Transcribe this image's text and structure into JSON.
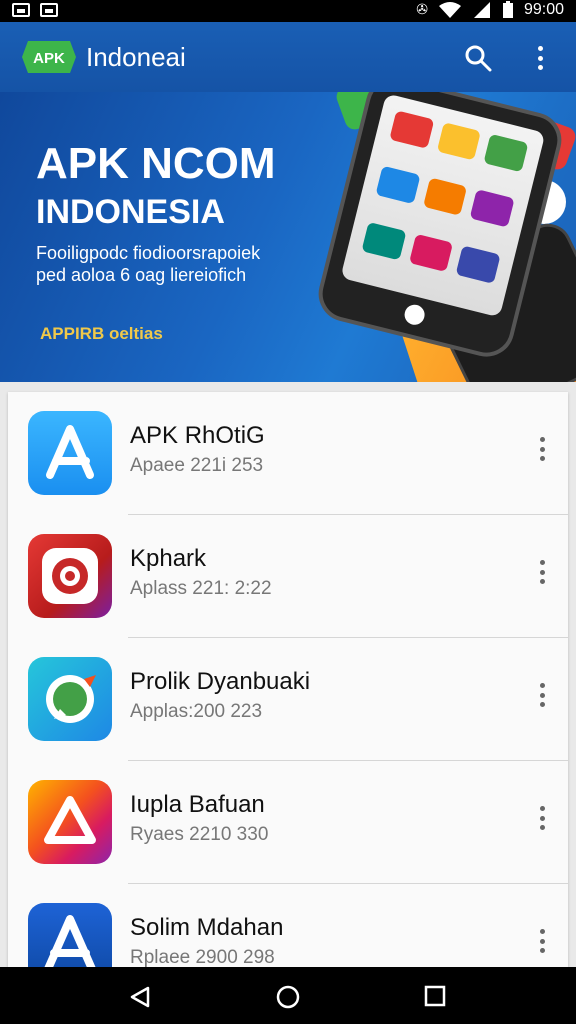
{
  "status_bar": {
    "time": "99:00",
    "icons": [
      "image-icon",
      "image-icon",
      "vibrate-icon",
      "wifi-icon",
      "signal-icon",
      "battery-icon"
    ]
  },
  "app_bar": {
    "logo_text": "APK",
    "title": "Indoneai",
    "search_icon": "search-icon",
    "menu_icon": "more-vert-icon"
  },
  "hero": {
    "title_line1": "APK NCOM",
    "title_line2": "INDONESIA",
    "subtitle_line1": "Fooiligpodc fiodioorsrapoiek",
    "subtitle_line2": "ped aoloa 6 oag liereiofich",
    "badge": "APPIRB oeltias"
  },
  "apps": [
    {
      "name": "APK RhOtiG",
      "meta": "Apaee 221i 253",
      "icon": "appstore-a-icon"
    },
    {
      "name": "Kphark",
      "meta": "Aplass 221: 2:22",
      "icon": "camera-ring-icon"
    },
    {
      "name": "Prolik Dyanbuaki",
      "meta": "Applas:200 223",
      "icon": "chat-bubble-icon"
    },
    {
      "name": "Iupla Bafuan",
      "meta": "Ryaes 2210 330",
      "icon": "triangle-icon"
    },
    {
      "name": "Solim Mdahan",
      "meta": "Rplaee 2900 298",
      "icon": "appstore-a-icon"
    }
  ],
  "nav": {
    "back_icon": "back-triangle-icon",
    "home_icon": "home-circle-icon",
    "recents_icon": "recents-square-icon"
  },
  "colors": {
    "primary": "#1a5fb5",
    "accent_green": "#3db54a",
    "accent_orange": "#f39a1f"
  }
}
